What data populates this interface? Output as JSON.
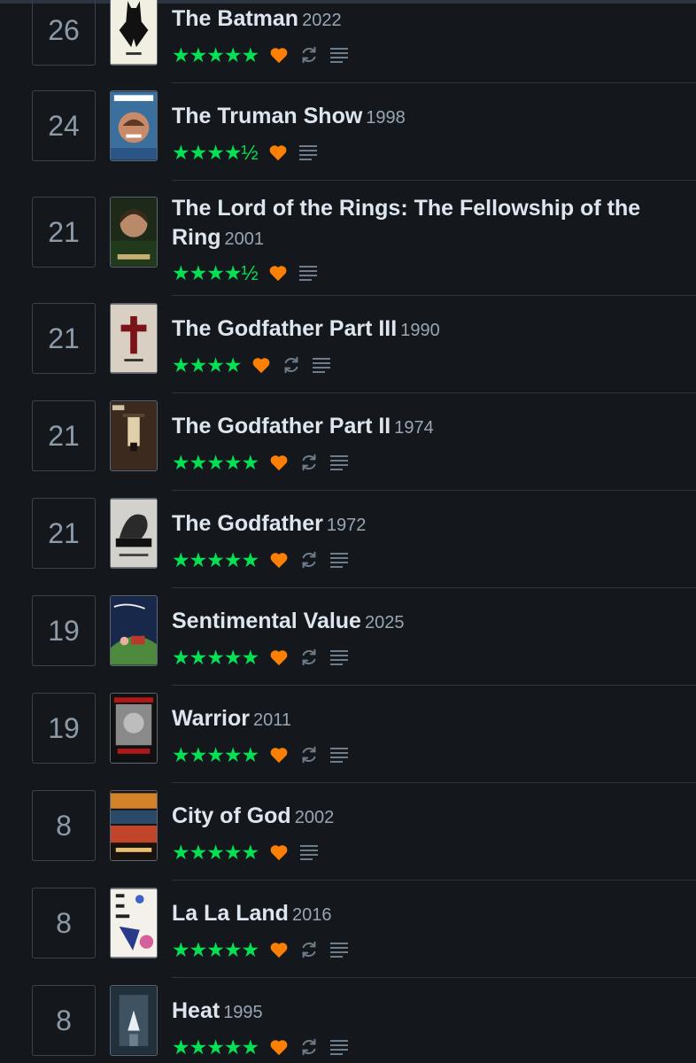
{
  "colors": {
    "background": "#14181c",
    "star_green": "#00e054",
    "heart_orange": "#ff8000",
    "title": "#dde6ee",
    "year": "#98a6b4",
    "muted_icon": "#6f7c89"
  },
  "entries": [
    {
      "day": "26",
      "title": "The Batman",
      "year": "2022",
      "stars": "★★★★★",
      "liked": true,
      "rewatch": true,
      "review": true,
      "icons": [
        "heart-icon",
        "rewatch-icon",
        "review-icon"
      ]
    },
    {
      "day": "24",
      "title": "The Truman Show",
      "year": "1998",
      "stars": "★★★★½",
      "liked": true,
      "rewatch": false,
      "review": true,
      "icons": [
        "heart-icon",
        "review-icon"
      ]
    },
    {
      "day": "21",
      "title": "The Lord of the Rings: The Fellowship of the Ring",
      "year": "2001",
      "stars": "★★★★½",
      "liked": true,
      "rewatch": false,
      "review": true,
      "icons": [
        "heart-icon",
        "review-icon"
      ]
    },
    {
      "day": "21",
      "title": "The Godfather Part III",
      "year": "1990",
      "stars": "★★★★",
      "liked": true,
      "rewatch": true,
      "review": true,
      "icons": [
        "heart-icon",
        "rewatch-icon",
        "review-icon"
      ]
    },
    {
      "day": "21",
      "title": "The Godfather Part II",
      "year": "1974",
      "stars": "★★★★★",
      "liked": true,
      "rewatch": true,
      "review": true,
      "icons": [
        "heart-icon",
        "rewatch-icon",
        "review-icon"
      ]
    },
    {
      "day": "21",
      "title": "The Godfather",
      "year": "1972",
      "stars": "★★★★★",
      "liked": true,
      "rewatch": true,
      "review": true,
      "icons": [
        "heart-icon",
        "rewatch-icon",
        "review-icon"
      ]
    },
    {
      "day": "19",
      "title": "Sentimental Value",
      "year": "2025",
      "stars": "★★★★★",
      "liked": true,
      "rewatch": true,
      "review": true,
      "icons": [
        "heart-icon",
        "rewatch-icon",
        "review-icon"
      ]
    },
    {
      "day": "19",
      "title": "Warrior",
      "year": "2011",
      "stars": "★★★★★",
      "liked": true,
      "rewatch": true,
      "review": true,
      "icons": [
        "heart-icon",
        "rewatch-icon",
        "review-icon"
      ]
    },
    {
      "day": "8",
      "title": "City of God",
      "year": "2002",
      "stars": "★★★★★",
      "liked": true,
      "rewatch": false,
      "review": true,
      "icons": [
        "heart-icon",
        "review-icon"
      ]
    },
    {
      "day": "8",
      "title": "La La Land",
      "year": "2016",
      "stars": "★★★★★",
      "liked": true,
      "rewatch": true,
      "review": true,
      "icons": [
        "heart-icon",
        "rewatch-icon",
        "review-icon"
      ]
    },
    {
      "day": "8",
      "title": "Heat",
      "year": "1995",
      "stars": "★★★★★",
      "liked": true,
      "rewatch": true,
      "review": true,
      "icons": [
        "heart-icon",
        "rewatch-icon",
        "review-icon"
      ]
    }
  ]
}
